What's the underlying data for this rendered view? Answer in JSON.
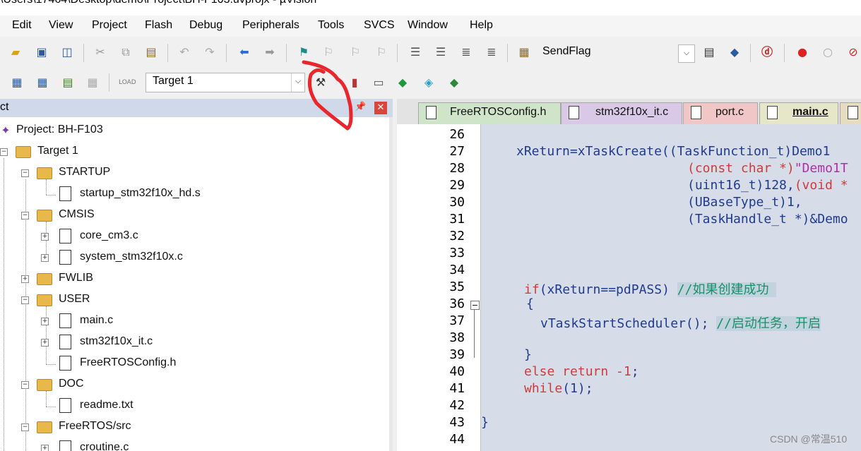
{
  "window": {
    "title": "\\Users\\17464\\Desktop\\demo\\Project\\BH-F103.uvprojx - µVision"
  },
  "menu": [
    "Edit",
    "View",
    "Project",
    "Flash",
    "Debug",
    "Peripherals",
    "Tools",
    "SVCS",
    "Window",
    "Help"
  ],
  "toolbar": {
    "send_flag_label": "SendFlag",
    "target_label": "Target 1"
  },
  "project_panel": {
    "title": "ct",
    "tree": [
      {
        "label": "Project: BH-F103",
        "type": "project"
      },
      {
        "label": "Target 1",
        "type": "target"
      },
      {
        "label": "STARTUP",
        "type": "folder"
      },
      {
        "label": "startup_stm32f10x_hd.s",
        "type": "file"
      },
      {
        "label": "CMSIS",
        "type": "folder"
      },
      {
        "label": "core_cm3.c",
        "type": "file"
      },
      {
        "label": "system_stm32f10x.c",
        "type": "file"
      },
      {
        "label": "FWLIB",
        "type": "folder"
      },
      {
        "label": "USER",
        "type": "folder"
      },
      {
        "label": "main.c",
        "type": "file"
      },
      {
        "label": "stm32f10x_it.c",
        "type": "file"
      },
      {
        "label": "FreeRTOSConfig.h",
        "type": "file"
      },
      {
        "label": "DOC",
        "type": "folder"
      },
      {
        "label": "readme.txt",
        "type": "file"
      },
      {
        "label": "FreeRTOS/src",
        "type": "folder"
      },
      {
        "label": "croutine.c",
        "type": "file"
      }
    ]
  },
  "editor": {
    "tabs": [
      {
        "label": "FreeRTOSConfig.h",
        "color": "#cfe4c8"
      },
      {
        "label": "stm32f10x_it.c",
        "color": "#d9c8e6"
      },
      {
        "label": "port.c",
        "color": "#f1c6c6"
      },
      {
        "label": "main.c",
        "color": "#e6e6c8",
        "active": true
      }
    ],
    "line_numbers": [
      "26",
      "27",
      "28",
      "29",
      "30",
      "31",
      "32",
      "33",
      "34",
      "35",
      "36",
      "37",
      "38",
      "39",
      "40",
      "41",
      "42",
      "43",
      "44"
    ],
    "code": {
      "l27": "xReturn=xTaskCreate((TaskFunction_t)Demo1",
      "l28a": "(const char *)",
      "l28b": "\"Demo1T",
      "l29a": "(uint16_t)128,",
      "l29b": "(void *",
      "l30": "(UBaseType_t)1,",
      "l31": "(TaskHandle_t *)&Demo",
      "l35a": "if",
      "l35b": "(xReturn==pdPASS) ",
      "l35c": "//如果创建成功 ",
      "l36": "{",
      "l37a": "vTaskStartScheduler(); ",
      "l37b": "//启动任务，开启",
      "l39": "}",
      "l40a": "else return -1",
      "l40b": ";",
      "l41a": "while",
      "l41b": "(1);",
      "l43": "}"
    }
  },
  "watermark": "CSDN @常温510"
}
